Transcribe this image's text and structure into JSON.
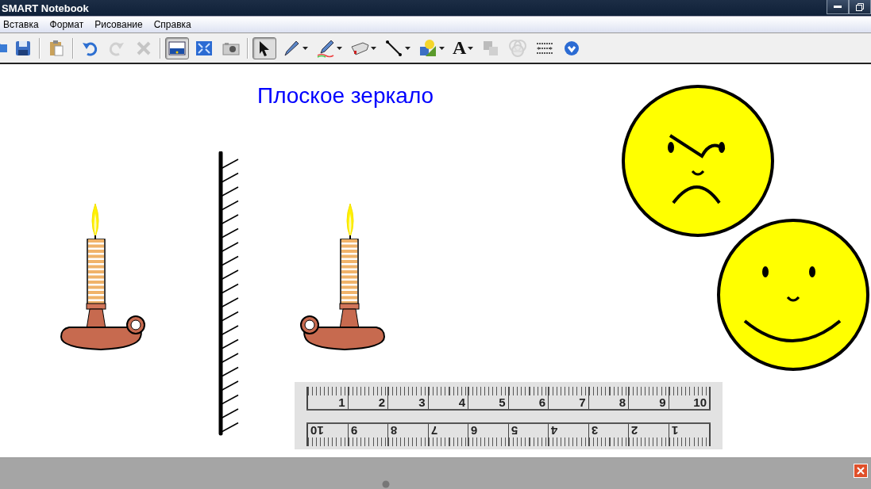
{
  "window": {
    "title": "SMART Notebook"
  },
  "menu": [
    "Вставка",
    "Формат",
    "Рисование",
    "Справка"
  ],
  "toolbar": [
    {
      "kind": "open",
      "selected": false,
      "disabled": false,
      "dropdown": false
    },
    {
      "kind": "save",
      "selected": false,
      "disabled": false,
      "dropdown": false
    },
    {
      "kind": "separator"
    },
    {
      "kind": "paste",
      "selected": false,
      "disabled": false,
      "dropdown": false
    },
    {
      "kind": "separator"
    },
    {
      "kind": "undo",
      "selected": false,
      "disabled": false,
      "dropdown": false
    },
    {
      "kind": "redo",
      "selected": false,
      "disabled": true,
      "dropdown": false
    },
    {
      "kind": "delete",
      "selected": false,
      "disabled": true,
      "dropdown": false
    },
    {
      "kind": "separator"
    },
    {
      "kind": "screen",
      "selected": true,
      "disabled": false,
      "dropdown": false
    },
    {
      "kind": "fullscreen",
      "selected": false,
      "disabled": false,
      "dropdown": false
    },
    {
      "kind": "camera",
      "selected": false,
      "disabled": false,
      "dropdown": false
    },
    {
      "kind": "separator"
    },
    {
      "kind": "select",
      "selected": true,
      "disabled": false,
      "dropdown": false
    },
    {
      "kind": "pen",
      "selected": false,
      "disabled": false,
      "dropdown": true
    },
    {
      "kind": "creative-pen",
      "selected": false,
      "disabled": false,
      "dropdown": true
    },
    {
      "kind": "eraser",
      "selected": false,
      "disabled": false,
      "dropdown": true
    },
    {
      "kind": "line",
      "selected": false,
      "disabled": false,
      "dropdown": true
    },
    {
      "kind": "shapes",
      "selected": false,
      "disabled": false,
      "dropdown": true
    },
    {
      "kind": "text",
      "label": "A",
      "selected": false,
      "disabled": false,
      "dropdown": true
    },
    {
      "kind": "group",
      "selected": false,
      "disabled": true,
      "dropdown": false
    },
    {
      "kind": "fill",
      "selected": false,
      "disabled": true,
      "dropdown": false
    },
    {
      "kind": "properties",
      "selected": false,
      "disabled": false,
      "dropdown": false
    },
    {
      "kind": "more",
      "selected": false,
      "disabled": false,
      "dropdown": false
    }
  ],
  "page": {
    "title": "Плоское зеркало",
    "faces": [
      {
        "kind": "angry"
      },
      {
        "kind": "happy"
      }
    ],
    "ruler": {
      "top_labels": [
        "1",
        "2",
        "3",
        "4",
        "5",
        "6",
        "7",
        "8",
        "9",
        "10"
      ],
      "bottom_labels": [
        "10",
        "9",
        "8",
        "7",
        "6",
        "5",
        "4",
        "3",
        "2",
        "1"
      ]
    }
  }
}
